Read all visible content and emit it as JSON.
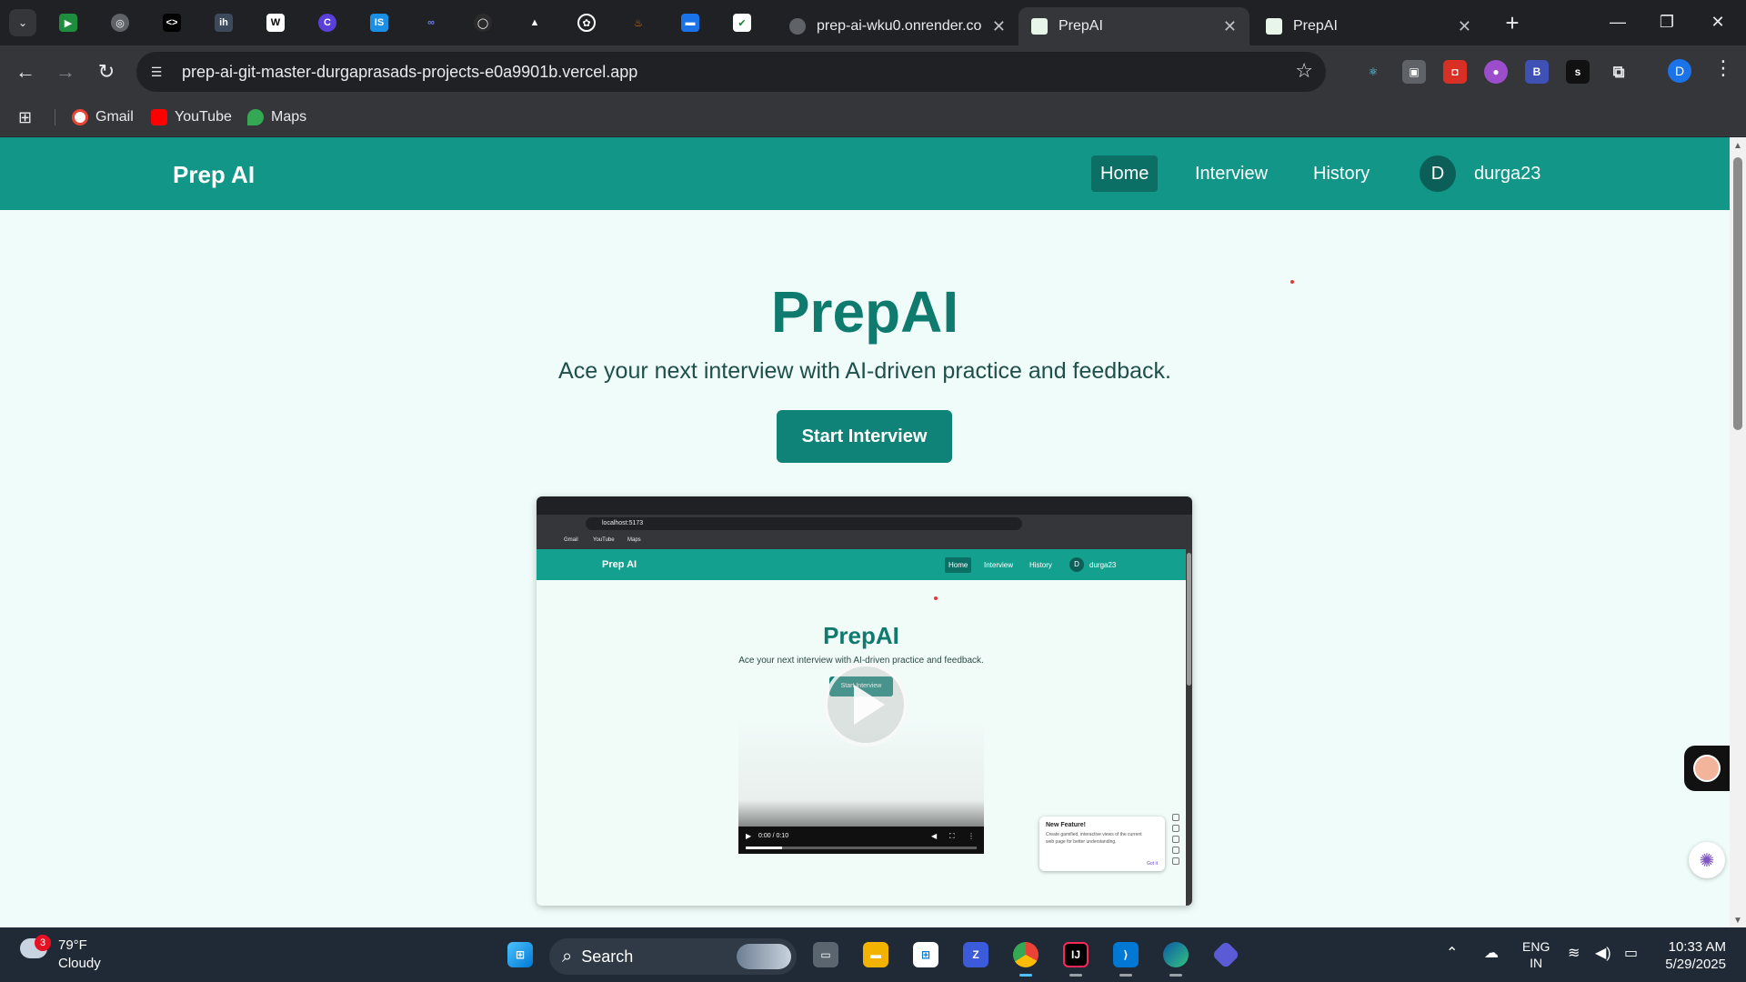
{
  "browser": {
    "tabs": [
      {
        "title": "prep-ai-wku0.onrender.co",
        "active": false
      },
      {
        "title": "PrepAI",
        "active": true
      },
      {
        "title": "PrepAI",
        "active": false
      }
    ],
    "address": "prep-ai-git-master-durgaprasads-projects-e0a9901b.vercel.app",
    "bookmarks": [
      "Gmail",
      "YouTube",
      "Maps"
    ],
    "profile_initial": "D"
  },
  "site": {
    "brand": "Prep AI",
    "nav": [
      "Home",
      "Interview",
      "History"
    ],
    "user_initial": "D",
    "username": "durga23",
    "accent": "#119688"
  },
  "hero": {
    "title": "PrepAI",
    "subtitle": "Ace your next interview with AI-driven practice and feedback.",
    "cta": "Start Interview"
  },
  "demo": {
    "address": "localhost:5173",
    "bookmarks": [
      "Gmail",
      "YouTube",
      "Maps"
    ],
    "brand": "Prep AI",
    "nav": [
      "Home",
      "Interview",
      "History"
    ],
    "user_initial": "D",
    "username": "durga23",
    "title": "PrepAI",
    "subtitle": "Ace your next interview with AI-driven practice and feedback.",
    "cta": "Start Interview",
    "video_time": "0:00 / 0:10",
    "toast": {
      "heading": "New Feature!",
      "body": "Create gamified, interactive views of the current web page for better understanding.",
      "action": "Got it"
    }
  },
  "taskbar": {
    "weather_badge": "3",
    "temperature": "79°F",
    "condition": "Cloudy",
    "search_label": "Search",
    "language": "ENG",
    "region": "IN",
    "time": "10:33 AM",
    "date": "5/29/2025"
  }
}
